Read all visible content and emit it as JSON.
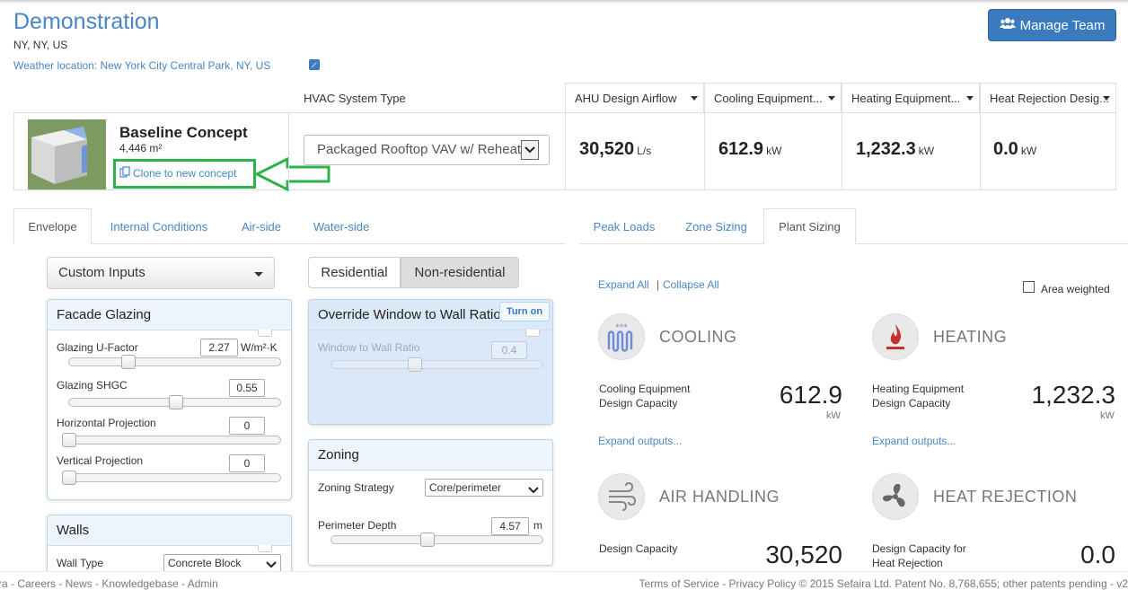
{
  "project": {
    "title": "Demonstration",
    "location": "NY, NY, US",
    "weather_location": "Weather location: New York City Central Park, NY, US"
  },
  "header": {
    "manage_team_label": "Manage Team"
  },
  "concept": {
    "name": "Baseline Concept",
    "area": "4,446 m²",
    "clone_link": "Clone to new concept",
    "hvac_label": "HVAC System Type",
    "hvac_value": "Packaged Rooftop VAV w/ Reheat"
  },
  "metrics": [
    {
      "header": "AHU Design Airflow",
      "value": "30,520",
      "unit": "L/s"
    },
    {
      "header": "Cooling Equipment...",
      "value": "612.9",
      "unit": "kW"
    },
    {
      "header": "Heating Equipment...",
      "value": "1,232.3",
      "unit": "kW"
    },
    {
      "header": "Heat Rejection Desig...",
      "value": "0.0",
      "unit": "kW"
    }
  ],
  "left_tabs": [
    "Envelope",
    "Internal Conditions",
    "Air-side",
    "Water-side"
  ],
  "right_tabs": [
    "Peak Loads",
    "Zone Sizing",
    "Plant Sizing"
  ],
  "inputs_dropdown": "Custom Inputs",
  "building_type": {
    "residential": "Residential",
    "non_residential": "Non-residential"
  },
  "facade": {
    "title": "Facade Glazing",
    "u_factor_label": "Glazing U-Factor",
    "u_factor_value": "2.27",
    "u_factor_unit": "W/m²·K",
    "shgc_label": "Glazing SHGC",
    "shgc_value": "0.55",
    "hproj_label": "Horizontal Projection",
    "hproj_value": "0",
    "vproj_label": "Vertical Projection",
    "vproj_value": "0"
  },
  "walls": {
    "title": "Walls",
    "wall_type_label": "Wall Type",
    "wall_type_value": "Concrete Block"
  },
  "override": {
    "title": "Override Window to Wall Ratio",
    "turn_on": "Turn on",
    "wwr_label": "Window to Wall Ratio",
    "wwr_value": "0.4"
  },
  "zoning": {
    "title": "Zoning",
    "strategy_label": "Zoning Strategy",
    "strategy_value": "Core/perimeter",
    "depth_label": "Perimeter Depth",
    "depth_value": "4.57",
    "depth_unit": "m"
  },
  "plant": {
    "expand_all": "Expand All",
    "separator": "|",
    "collapse_all": "Collapse All",
    "area_weighted": "Area weighted",
    "cooling": {
      "title": "COOLING",
      "label1": "Cooling Equipment",
      "label2": "Design Capacity",
      "value": "612.9",
      "unit": "kW",
      "expand": "Expand outputs..."
    },
    "heating": {
      "title": "HEATING",
      "label1": "Heating Equipment",
      "label2": "Design Capacity",
      "value": "1,232.3",
      "unit": "kW",
      "expand": "Expand outputs..."
    },
    "air_handling": {
      "title": "AIR HANDLING",
      "label1": "Design Capacity",
      "value": "30,520"
    },
    "heat_rejection": {
      "title": "HEAT REJECTION",
      "label1": "Design Capacity for",
      "label2": "Heat Rejection",
      "value": "0.0"
    }
  },
  "footer": {
    "left": "ra - Careers - News - Knowledgebase - Admin",
    "right": "Terms of Service - Privacy Policy © 2015 Sefaira Ltd. Patent No. 8,768,655; other patents pending - v2"
  }
}
